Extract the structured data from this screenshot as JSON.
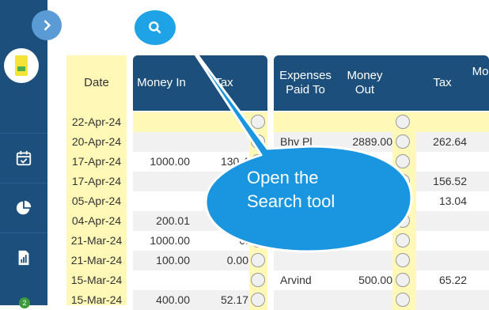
{
  "headers": {
    "date": "Date",
    "money_in": "Money In",
    "tax1": "Tax",
    "expenses_paid_to": "Expenses Paid To",
    "money_out": "Money Out",
    "tax2": "Tax",
    "more": "Mo"
  },
  "rows": [
    {
      "date": "22-Apr-24",
      "money_in": "",
      "tax1": "",
      "payee": "",
      "money_out": "",
      "tax2": ""
    },
    {
      "date": "20-Apr-24",
      "money_in": "",
      "tax1": "",
      "payee": "Bhv Pl",
      "money_out": "2889.00",
      "tax2": "262.64"
    },
    {
      "date": "17-Apr-24",
      "money_in": "1000.00",
      "tax1": "130.4",
      "payee": "",
      "money_out": "",
      "tax2": ""
    },
    {
      "date": "17-Apr-24",
      "money_in": "",
      "tax1": "",
      "payee": "",
      "money_out": "",
      "tax2": "156.52"
    },
    {
      "date": "05-Apr-24",
      "money_in": "",
      "tax1": "",
      "payee": "",
      "money_out": "",
      "tax2": "13.04"
    },
    {
      "date": "04-Apr-24",
      "money_in": "200.01",
      "tax1": "",
      "payee": "",
      "money_out": "",
      "tax2": ""
    },
    {
      "date": "21-Mar-24",
      "money_in": "1000.00",
      "tax1": "0.",
      "payee": "",
      "money_out": "",
      "tax2": ""
    },
    {
      "date": "21-Mar-24",
      "money_in": "100.00",
      "tax1": "0.00",
      "payee": "",
      "money_out": "",
      "tax2": ""
    },
    {
      "date": "15-Mar-24",
      "money_in": "",
      "tax1": "",
      "payee": "Arvind",
      "money_out": "500.00",
      "tax2": "65.22"
    },
    {
      "date": "15-Mar-24",
      "money_in": "400.00",
      "tax1": "52.17",
      "payee": "",
      "money_out": "",
      "tax2": ""
    }
  ],
  "callout": {
    "text": "Open the Search tool"
  },
  "sidebar": {
    "icons": [
      "calendar-icon",
      "pie-chart-icon",
      "report-icon"
    ],
    "badge": "2"
  },
  "colors": {
    "sidebar": "#1d4f7c",
    "date_column": "#fff8b6",
    "callout": "#1a96e0",
    "search_button": "#1ea3e6"
  }
}
